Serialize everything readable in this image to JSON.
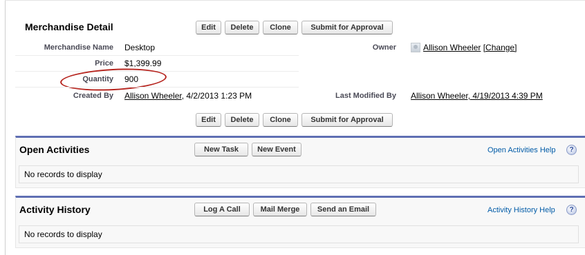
{
  "detail": {
    "title": "Merchandise Detail",
    "buttons": {
      "edit": "Edit",
      "delete": "Delete",
      "clone": "Clone",
      "submit": "Submit for Approval"
    },
    "fields": {
      "name": {
        "label": "Merchandise Name",
        "value": "Desktop"
      },
      "price": {
        "label": "Price",
        "value": "$1,399.99"
      },
      "quantity": {
        "label": "Quantity",
        "value": "900"
      },
      "created_by": {
        "label": "Created By",
        "user": "Allison Wheeler",
        "date": ", 4/2/2013 1:23 PM"
      },
      "owner": {
        "label": "Owner",
        "user": "Allison Wheeler",
        "change": "[Change]"
      },
      "last_modified_by": {
        "label": "Last Modified By",
        "text": "Allison Wheeler, 4/19/2013 4:39 PM"
      }
    }
  },
  "open_activities": {
    "title": "Open Activities",
    "buttons": {
      "new_task": "New Task",
      "new_event": "New Event"
    },
    "help_link": "Open Activities Help",
    "empty_text": "No records to display"
  },
  "activity_history": {
    "title": "Activity History",
    "buttons": {
      "log_call": "Log A Call",
      "mail_merge": "Mail Merge",
      "send_email": "Send an Email"
    },
    "help_link": "Activity History Help",
    "empty_text": "No records to display"
  },
  "icons": {
    "help": "?"
  },
  "colors": {
    "panel_accent": "#5f6fb3",
    "annotation_oval": "#b6241e",
    "help_link": "#015ba7"
  }
}
